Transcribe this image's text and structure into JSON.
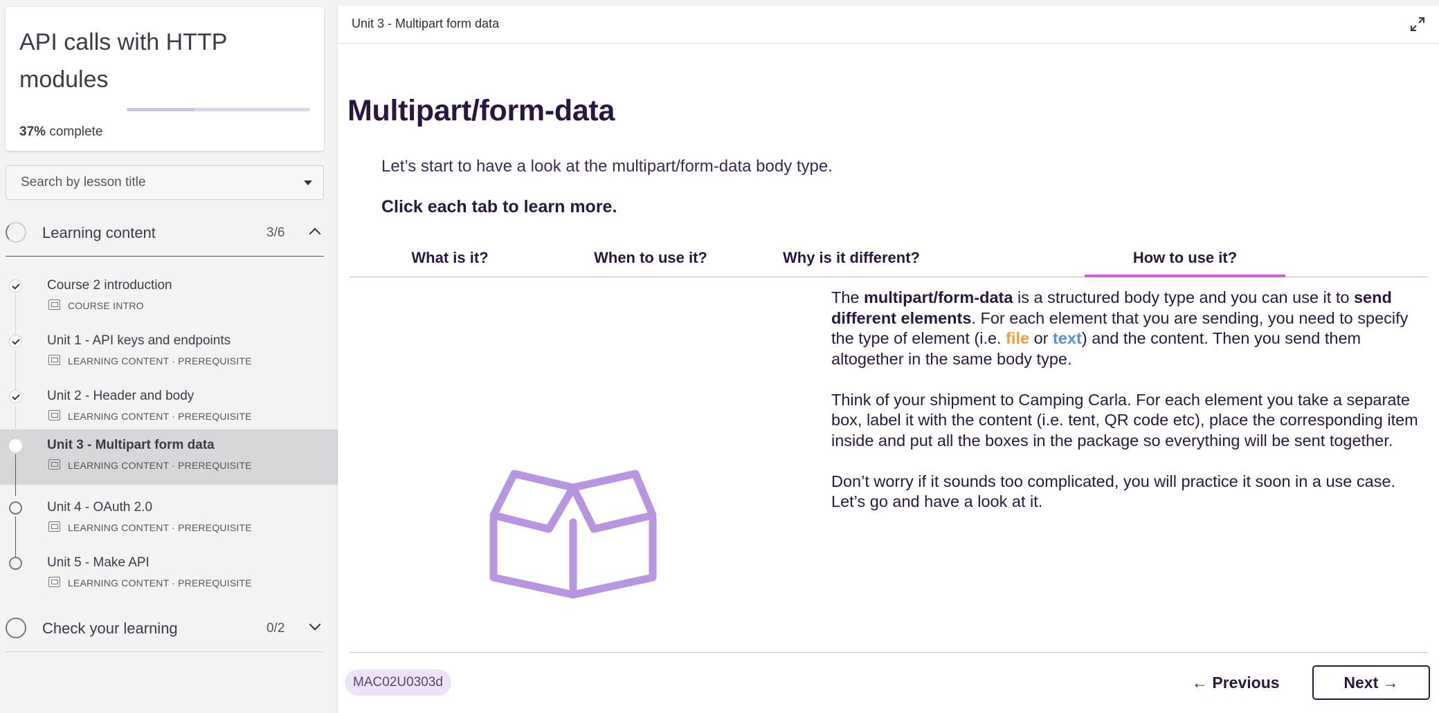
{
  "sidebar": {
    "course_title": "API calls with HTTP modules",
    "progress": {
      "percent_label": "37%",
      "suffix": "complete",
      "fraction": 0.37
    },
    "search": {
      "placeholder": "Search by lesson title"
    },
    "sections": [
      {
        "label": "Learning content",
        "count": "3/6",
        "expanded": true,
        "lessons": [
          {
            "title": "Course 2 introduction",
            "meta": "COURSE INTRO",
            "status": "done"
          },
          {
            "title": "Unit 1 - API keys and endpoints",
            "meta": "LEARNING CONTENT · PREREQUISITE",
            "status": "done"
          },
          {
            "title": "Unit 2 - Header and body",
            "meta": "LEARNING CONTENT · PREREQUISITE",
            "status": "done"
          },
          {
            "title": "Unit 3 - Multipart form data",
            "meta": "LEARNING CONTENT · PREREQUISITE",
            "status": "current"
          },
          {
            "title": "Unit 4 - OAuth 2.0",
            "meta": "LEARNING CONTENT · PREREQUISITE",
            "status": "open"
          },
          {
            "title": "Unit 5 - Make API",
            "meta": "LEARNING CONTENT · PREREQUISITE",
            "status": "open"
          }
        ]
      },
      {
        "label": "Check your learning",
        "count": "0/2",
        "expanded": false
      }
    ]
  },
  "main": {
    "breadcrumb": "Unit 3 - Multipart form data",
    "title": "Multipart/form-data",
    "intro": "Let’s start to have a look at the multipart/form-data body type.",
    "cta": "Click each tab to learn more.",
    "tabs": [
      {
        "label": "What is it?",
        "active": false
      },
      {
        "label": "When to use it?",
        "active": false
      },
      {
        "label": "Why is it different?",
        "active": false
      },
      {
        "label": "How to use it?",
        "active": true
      }
    ],
    "content": {
      "p1": {
        "t1": "The ",
        "b1": "multipart/form-data",
        "t2": " is a structured body type and you can use it to ",
        "b2": "send different elements",
        "t3": ". For each element that you are sending, you need to specify the type of element (i.e. ",
        "file": "file",
        "t4": " or ",
        "text": "text",
        "t5": ") and the content. Then you send them altogether in the same body type."
      },
      "p2": "Think of your shipment to Camping Carla. For each element you take a separate box, label it with the content (i.e. tent, QR code etc), place the corresponding item inside and put all the boxes in the package so everything will be sent together.",
      "p3": "Don’t worry if it sounds too complicated, you will practice it soon in a use case. Let’s go and have a look at it."
    },
    "illustration_icon": "open-box-icon",
    "code_badge": "MAC02U0303d",
    "prev_label": "← Previous",
    "next_label": "Next →"
  },
  "colors": {
    "accent_tab": "#d35ae8",
    "heading": "#2a1740",
    "file": "#f29a3c",
    "text": "#5b8fd8",
    "box": "#b795e0",
    "badge_bg": "#ede3f6"
  }
}
